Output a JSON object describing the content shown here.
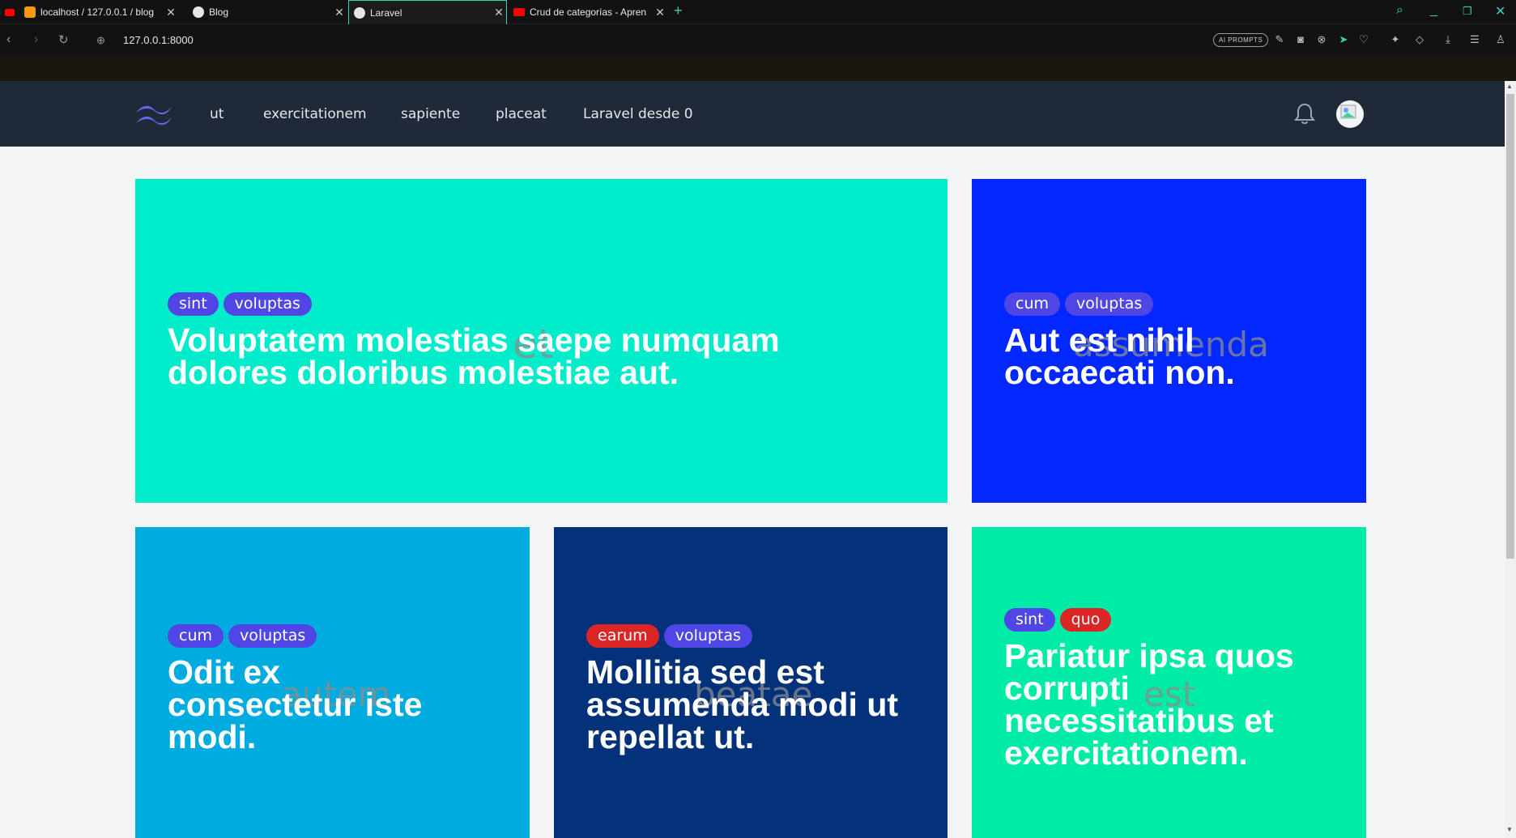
{
  "browser": {
    "tabs": [
      {
        "title": "localhost / 127.0.0.1 / blog",
        "active": false
      },
      {
        "title": "Blog",
        "active": false
      },
      {
        "title": "Laravel",
        "active": true
      },
      {
        "title": "Crud de categorías - Apren",
        "active": false
      }
    ],
    "new_tab": "+",
    "url": "127.0.0.1:8000",
    "ai_prompts_label": "AI PROMPTS"
  },
  "site": {
    "nav_links": [
      "ut",
      "exercitationem",
      "sapiente",
      "placeat",
      "Laravel desde 0"
    ]
  },
  "colors": {
    "tag_indigo": "#4f46e5",
    "tag_red": "#dc2626",
    "card1": "#00ecca",
    "card2": "#0328ff",
    "card3": "#00abdf",
    "card4": "#03327b",
    "card5": "#00eca6"
  },
  "posts": [
    {
      "tags": [
        "sint",
        "voluptas"
      ],
      "title": "Voluptatem molestias saepe numquam dolores doloribus molestiae aut.",
      "image_alt": "et"
    },
    {
      "tags": [
        "cum",
        "voluptas"
      ],
      "title": "Aut est nihil occaecati non.",
      "image_alt": "assumenda"
    },
    {
      "tags": [
        "cum",
        "voluptas"
      ],
      "title": "Odit ex consectetur iste modi.",
      "image_alt": "autem"
    },
    {
      "tags": [
        "earum",
        "voluptas"
      ],
      "title": "Mollitia sed est assumenda modi ut repellat ut.",
      "image_alt": "beatae"
    },
    {
      "tags": [
        "sint",
        "quo"
      ],
      "title": "Pariatur ipsa quos corrupti necessitatibus et exercitationem.",
      "image_alt": "est"
    }
  ]
}
